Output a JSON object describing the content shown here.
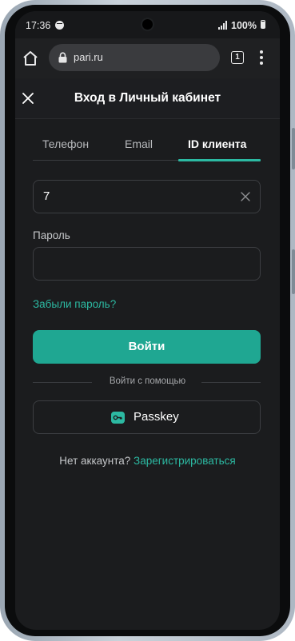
{
  "status_bar": {
    "time": "17:36",
    "battery": "100%"
  },
  "browser": {
    "url": "pari.ru",
    "tab_count": "1"
  },
  "header": {
    "title": "Вход в Личный кабинет"
  },
  "tabs": [
    {
      "label": "Телефон",
      "active": false
    },
    {
      "label": "Email",
      "active": false
    },
    {
      "label": "ID клиента",
      "active": true
    }
  ],
  "form": {
    "client_id_value": "7",
    "password_label": "Пароль",
    "password_value": "",
    "forgot_password": "Забыли пароль?",
    "login_button": "Войти",
    "alt_login_text": "Войти с помощью",
    "passkey_button": "Passkey",
    "no_account_text": "Нет аккаунта?",
    "register_link": "Зарегистрироваться"
  },
  "colors": {
    "accent": "#2cb9a2",
    "button": "#1fa792",
    "background": "#1b1c1e"
  }
}
